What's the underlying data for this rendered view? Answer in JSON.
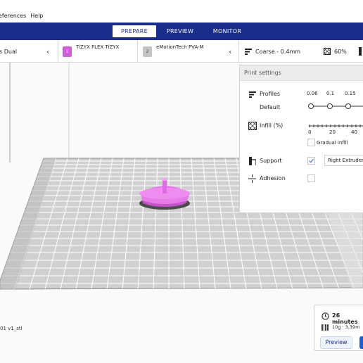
{
  "menubar": {
    "preferences": "eferences",
    "help": "Help"
  },
  "stages": {
    "prepare": "PREPARE",
    "preview": "PREVIEW",
    "monitor": "MONITOR"
  },
  "printer": {
    "name": "s Dual"
  },
  "extruders": [
    {
      "index": "1",
      "material": "TiZYX FLEX TiZYX",
      "color": "#d25ce0"
    },
    {
      "index": "2",
      "material": "eMotionTech PVA-M",
      "color": "#c4c4c4"
    }
  ],
  "settings_summary": {
    "profile": "Coarse - 0.4mm",
    "infill": "60%"
  },
  "print_settings": {
    "title": "Print settings",
    "profiles_label": "Profiles",
    "profile_default": "Default",
    "layer_ticks": [
      "0.06",
      "0.1",
      "0.15"
    ],
    "infill_label": "Infill (%)",
    "infill_ticks": [
      "0",
      "20",
      "40"
    ],
    "gradual_infill": "Gradual infill",
    "support_label": "Support",
    "support_extruder": "Right Extruder",
    "adhesion_label": "Adhesion"
  },
  "model": {
    "filename": "01 v1_stl"
  },
  "estimate": {
    "time": "26 minutes",
    "material": "10g · 3.39m",
    "preview_button": "Preview"
  },
  "colors": {
    "brand_blue": "#1b2d8a",
    "model_pink": "#e77ce8",
    "accent_blue": "#1e5fd6"
  }
}
